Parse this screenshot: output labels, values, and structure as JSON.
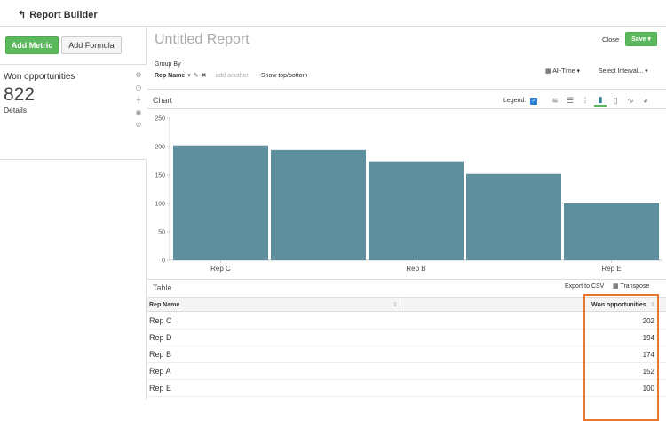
{
  "header": {
    "back_label": "Report Builder"
  },
  "sidebar": {
    "add_metric": "Add Metric",
    "add_formula": "Add Formula",
    "metric": {
      "name": "Won opportunities",
      "value": "822",
      "details": "Details"
    }
  },
  "report": {
    "title": "Untitled Report",
    "close_label": "Close",
    "save_label": "Save",
    "group_by_label": "Group By",
    "group_by_value": "Rep Name",
    "add_another": "add another",
    "show_top_bottom": "Show top/bottom",
    "time_range": "All-Time",
    "interval": "Select Interval..."
  },
  "chart_panel": {
    "title": "Chart",
    "legend_label": "Legend:"
  },
  "table_panel": {
    "title": "Table",
    "export": "Export to CSV",
    "transpose": "Transpose",
    "columns": [
      "Rep Name",
      "Won opportunities"
    ],
    "rows": [
      {
        "name": "Rep C",
        "value": "202"
      },
      {
        "name": "Rep D",
        "value": "194"
      },
      {
        "name": "Rep B",
        "value": "174"
      },
      {
        "name": "Rep A",
        "value": "152"
      },
      {
        "name": "Rep E",
        "value": "100"
      }
    ]
  },
  "colors": {
    "bar": "#5e8f9e",
    "accent_green": "#5cb85c",
    "highlight": "#e8762c"
  },
  "chart_data": {
    "type": "bar",
    "categories": [
      "Rep C",
      "Rep D",
      "Rep B",
      "Rep A",
      "Rep E"
    ],
    "values": [
      202,
      194,
      174,
      152,
      100
    ],
    "x_tick_labels": [
      "Rep C",
      "Rep B",
      "Rep E"
    ],
    "y_ticks": [
      0,
      50,
      100,
      150,
      200,
      250
    ],
    "ylim": [
      0,
      250
    ],
    "title": "",
    "xlabel": "",
    "ylabel": "",
    "grid": false
  }
}
